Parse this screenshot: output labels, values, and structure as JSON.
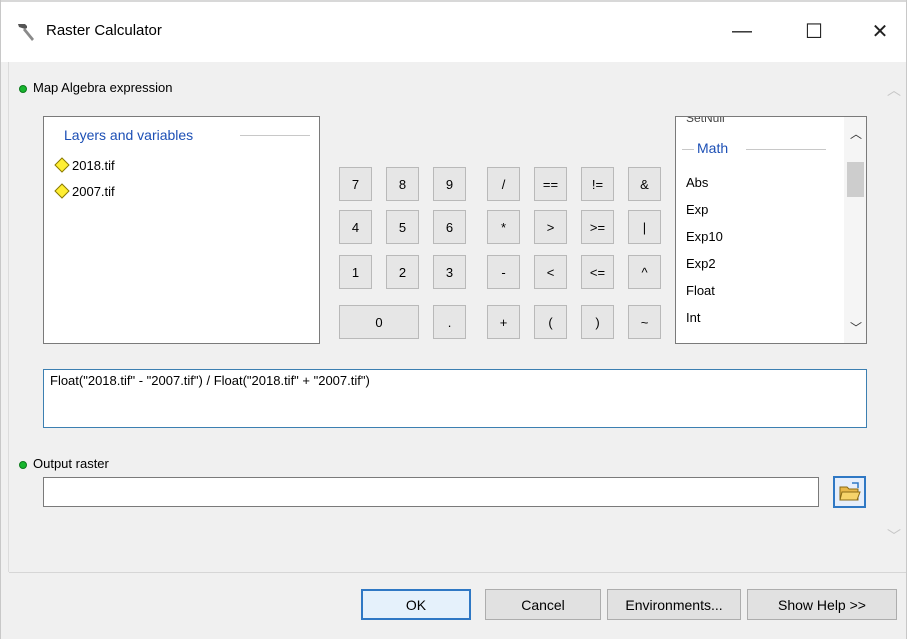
{
  "window": {
    "title": "Raster Calculator",
    "controls": {
      "minimize": "—",
      "maximize": "☐",
      "close": "✕"
    }
  },
  "map_algebra": {
    "label": "Map Algebra expression"
  },
  "layers": {
    "header": "Layers and variables",
    "items": [
      "2018.tif",
      "2007.tif"
    ]
  },
  "calculator": {
    "rows": [
      [
        "7",
        "8",
        "9",
        "/",
        "==",
        "!=",
        "&"
      ],
      [
        "4",
        "5",
        "6",
        "*",
        ">",
        ">=",
        "|"
      ],
      [
        "1",
        "2",
        "3",
        "-",
        "<",
        "<=",
        "^"
      ],
      [
        "0",
        ".",
        "+",
        "(",
        ")",
        "~"
      ]
    ]
  },
  "functions": {
    "clipped_item": "SetNull",
    "group_header": "Math",
    "items": [
      "Abs",
      "Exp",
      "Exp10",
      "Exp2",
      "Float",
      "Int"
    ]
  },
  "expression": {
    "value": "Float(\"2018.tif\" - \"2007.tif\") / Float(\"2018.tif\" + \"2007.tif\")"
  },
  "output": {
    "label": "Output raster",
    "value": ""
  },
  "buttons": {
    "ok": "OK",
    "cancel": "Cancel",
    "environments": "Environments...",
    "show_help": "Show Help >>"
  },
  "colors": {
    "accent": "#2f78c4",
    "group_header": "#1c4fb5",
    "bullet": "#17b52e"
  }
}
